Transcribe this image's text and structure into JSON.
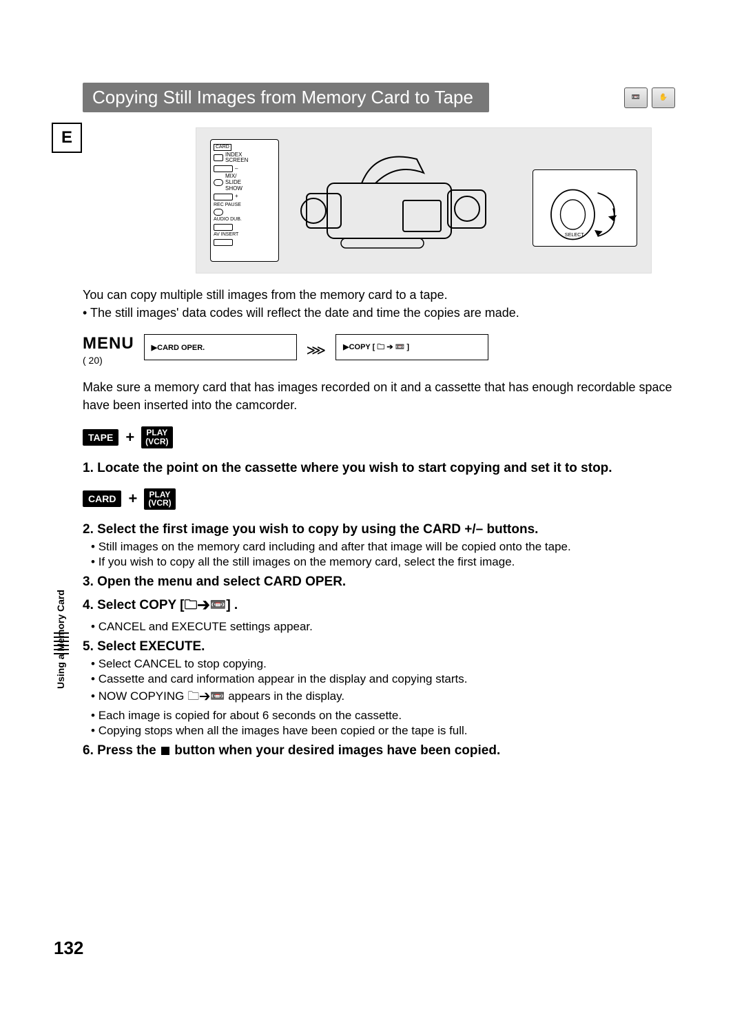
{
  "language_badge": "E",
  "title": "Copying Still Images from Memory Card to Tape",
  "illustration": {
    "remote_labels": {
      "card": "CARD",
      "index": "INDEX\nSCREEN",
      "mix": "MIX/\nSLIDE\nSHOW",
      "rec_pause": "REC PAUSE",
      "audio_dub": "AUDIO DUB.",
      "av_insert": "AV INSERT"
    },
    "dial_label": "SELECT"
  },
  "intro_line": "You can copy multiple still images from the memory card to a tape.",
  "intro_bullet": "The still images' data codes will reflect the date and time the copies are made.",
  "menu": {
    "label": "MENU",
    "ref": "(      20)",
    "box1": "▶CARD OPER.",
    "box2": "▶COPY [ 🗀 ➔ 📼 ]"
  },
  "precond": "Make sure a memory card that has images recorded on it and a cassette that has enough recordable space have been inserted into the camcorder.",
  "tags": {
    "tape": "TAPE",
    "card": "CARD",
    "play1": "PLAY",
    "play2": "(VCR)"
  },
  "step1": "1. Locate the point on the cassette where you wish to start copying and set it to stop.",
  "step2": "2. Select the first image you wish to copy by using the CARD +/– buttons.",
  "step2_b1": "Still images on the memory card including and after that image will be copied onto the tape.",
  "step2_b2": "If you wish to copy all the still images on the memory card, select the first image.",
  "step3": "3. Open the menu and select CARD OPER.",
  "step4": "4. Select COPY   [🗀➔📼] .",
  "step4_b1": "CANCEL and EXECUTE settings appear.",
  "step5": "5. Select EXECUTE.",
  "step5_b1": "Select CANCEL to stop copying.",
  "step5_b2": "Cassette and card information appear in the display and copying starts.",
  "step5_b3": "NOW COPYING 🗀➔📼     appears in the display.",
  "step5_b4": "Each image is copied for about 6 seconds on the cassette.",
  "step5_b5": "Copying stops when all the images have been copied or the tape is full.",
  "step6_pre": "6. Press the ",
  "step6_post": " button when your desired images have been copied.",
  "side_section": "Using a Memory Card",
  "page_number": "132"
}
